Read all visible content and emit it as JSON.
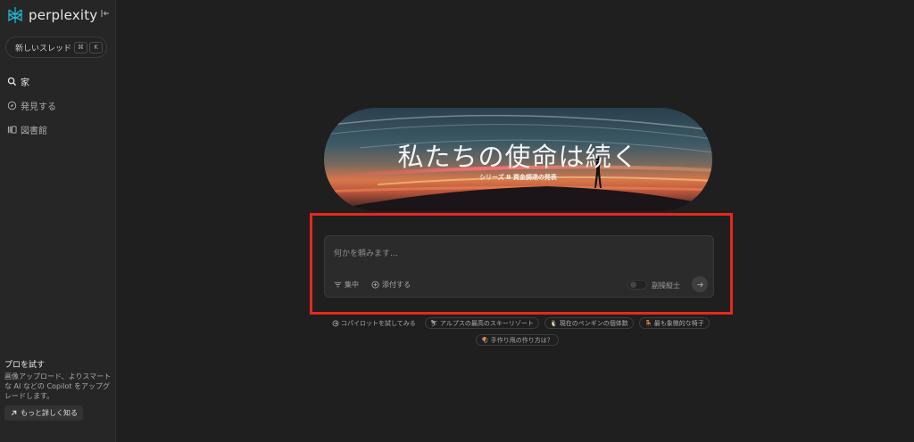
{
  "app": {
    "name": "perplexity"
  },
  "sidebar": {
    "new_thread": {
      "label": "新しいスレッド",
      "shortcut_mod": "⌘",
      "shortcut_key": "K"
    },
    "nav": [
      {
        "label": "家",
        "icon": "search-icon",
        "active": true
      },
      {
        "label": "発見する",
        "icon": "compass-icon",
        "active": false
      },
      {
        "label": "図書館",
        "icon": "library-icon",
        "active": false
      }
    ],
    "pro": {
      "title": "プロを試す",
      "desc": "画像アップロード、よりスマートな AI などの Copilot をアップグレードします。",
      "more": "もっと詳しく知る"
    }
  },
  "banner": {
    "headline": "私たちの使命は続く",
    "subline": "シリーズ B 資金調達の発表"
  },
  "search": {
    "placeholder": "何かを頼みます...",
    "focus_label": "集中",
    "attach_label": "添付する",
    "copilot_label": "副操縦士",
    "copilot_enabled": false
  },
  "suggestions": [
    {
      "label": "コパイロットを試してみる",
      "icon": "copilot-icon"
    },
    {
      "label": "アルプスの最高のスキーリゾート",
      "icon": "ski-emoji"
    },
    {
      "label": "現在のペンギンの個体数",
      "icon": "penguin-emoji"
    },
    {
      "label": "最も象徴的な椅子",
      "icon": "chair-emoji"
    },
    {
      "label": "手作り凧の作り方は？",
      "icon": "kite-emoji"
    }
  ],
  "colors": {
    "highlight": "#e8281d",
    "accent": "#20b8cd",
    "background": "#1f1f1f"
  }
}
